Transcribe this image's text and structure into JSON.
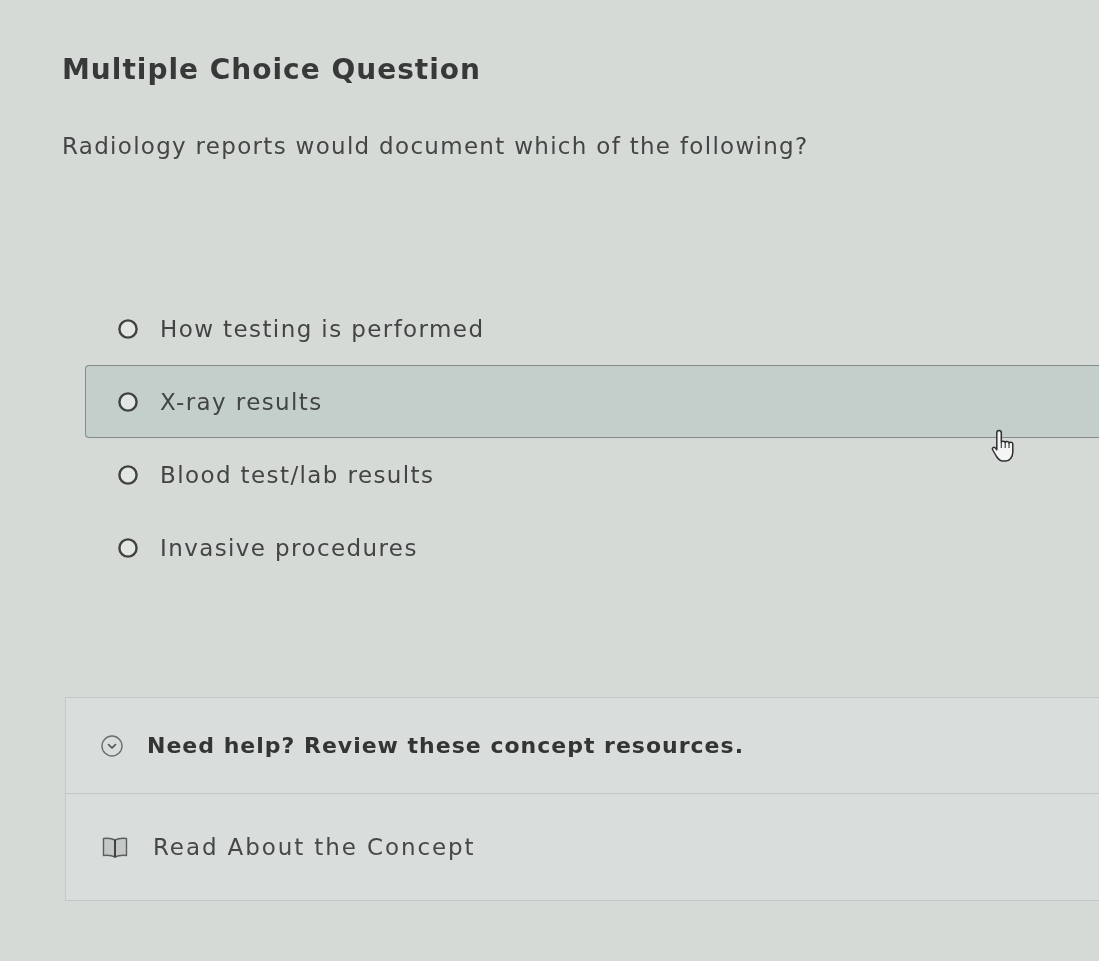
{
  "question": {
    "heading": "Multiple Choice Question",
    "prompt": "Radiology reports would document which of the following?"
  },
  "options": [
    {
      "label": "How testing is performed",
      "selected": false,
      "hovered": false
    },
    {
      "label": "X-ray results",
      "selected": false,
      "hovered": true
    },
    {
      "label": "Blood test/lab results",
      "selected": false,
      "hovered": false
    },
    {
      "label": "Invasive procedures",
      "selected": false,
      "hovered": false
    }
  ],
  "help": {
    "title": "Need help? Review these concept resources.",
    "expanded": true,
    "resources": [
      {
        "label": "Read About the Concept"
      }
    ]
  }
}
